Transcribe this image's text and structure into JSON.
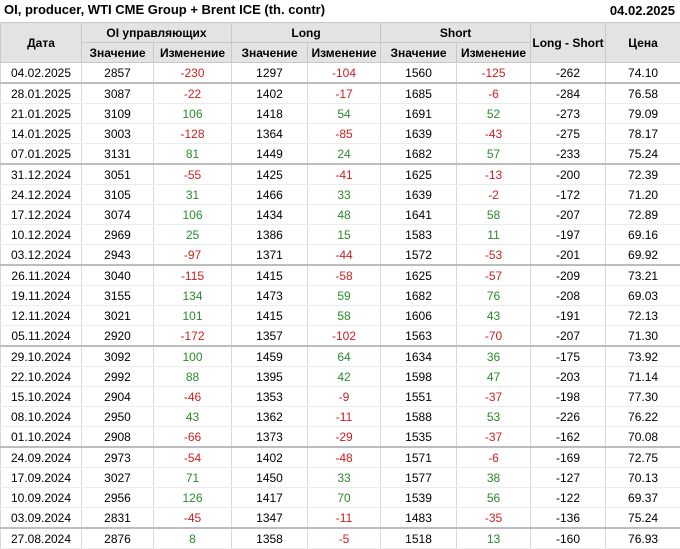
{
  "header": {
    "title": "OI, producer, WTI CME Group + Brent ICE (th. contr)",
    "date": "04.02.2025"
  },
  "columns": {
    "date": "Дата",
    "oi": "OI управляющих",
    "long": "Long",
    "short": "Short",
    "long_short": "Long - Short",
    "price": "Цена",
    "value": "Значение",
    "change": "Изменение"
  },
  "colors": {
    "positive": "#2a8a2a",
    "negative": "#cc2020",
    "header_bg": "#e3e3e3"
  },
  "rows": [
    {
      "date": "04.02.2025",
      "oi": "2857",
      "oi_chg": "-230",
      "long": "1297",
      "long_chg": "-104",
      "short": "1560",
      "short_chg": "-125",
      "ls": "-262",
      "price": "74.10"
    },
    {
      "date": "28.01.2025",
      "oi": "3087",
      "oi_chg": "-22",
      "long": "1402",
      "long_chg": "-17",
      "short": "1685",
      "short_chg": "-6",
      "ls": "-284",
      "price": "76.58"
    },
    {
      "date": "21.01.2025",
      "oi": "3109",
      "oi_chg": "106",
      "long": "1418",
      "long_chg": "54",
      "short": "1691",
      "short_chg": "52",
      "ls": "-273",
      "price": "79.09"
    },
    {
      "date": "14.01.2025",
      "oi": "3003",
      "oi_chg": "-128",
      "long": "1364",
      "long_chg": "-85",
      "short": "1639",
      "short_chg": "-43",
      "ls": "-275",
      "price": "78.17"
    },
    {
      "date": "07.01.2025",
      "oi": "3131",
      "oi_chg": "81",
      "long": "1449",
      "long_chg": "24",
      "short": "1682",
      "short_chg": "57",
      "ls": "-233",
      "price": "75.24"
    },
    {
      "date": "31.12.2024",
      "oi": "3051",
      "oi_chg": "-55",
      "long": "1425",
      "long_chg": "-41",
      "short": "1625",
      "short_chg": "-13",
      "ls": "-200",
      "price": "72.39"
    },
    {
      "date": "24.12.2024",
      "oi": "3105",
      "oi_chg": "31",
      "long": "1466",
      "long_chg": "33",
      "short": "1639",
      "short_chg": "-2",
      "ls": "-172",
      "price": "71.20"
    },
    {
      "date": "17.12.2024",
      "oi": "3074",
      "oi_chg": "106",
      "long": "1434",
      "long_chg": "48",
      "short": "1641",
      "short_chg": "58",
      "ls": "-207",
      "price": "72.89"
    },
    {
      "date": "10.12.2024",
      "oi": "2969",
      "oi_chg": "25",
      "long": "1386",
      "long_chg": "15",
      "short": "1583",
      "short_chg": "11",
      "ls": "-197",
      "price": "69.16"
    },
    {
      "date": "03.12.2024",
      "oi": "2943",
      "oi_chg": "-97",
      "long": "1371",
      "long_chg": "-44",
      "short": "1572",
      "short_chg": "-53",
      "ls": "-201",
      "price": "69.92"
    },
    {
      "date": "26.11.2024",
      "oi": "3040",
      "oi_chg": "-115",
      "long": "1415",
      "long_chg": "-58",
      "short": "1625",
      "short_chg": "-57",
      "ls": "-209",
      "price": "73.21"
    },
    {
      "date": "19.11.2024",
      "oi": "3155",
      "oi_chg": "134",
      "long": "1473",
      "long_chg": "59",
      "short": "1682",
      "short_chg": "76",
      "ls": "-208",
      "price": "69.03"
    },
    {
      "date": "12.11.2024",
      "oi": "3021",
      "oi_chg": "101",
      "long": "1415",
      "long_chg": "58",
      "short": "1606",
      "short_chg": "43",
      "ls": "-191",
      "price": "72.13"
    },
    {
      "date": "05.11.2024",
      "oi": "2920",
      "oi_chg": "-172",
      "long": "1357",
      "long_chg": "-102",
      "short": "1563",
      "short_chg": "-70",
      "ls": "-207",
      "price": "71.30"
    },
    {
      "date": "29.10.2024",
      "oi": "3092",
      "oi_chg": "100",
      "long": "1459",
      "long_chg": "64",
      "short": "1634",
      "short_chg": "36",
      "ls": "-175",
      "price": "73.92"
    },
    {
      "date": "22.10.2024",
      "oi": "2992",
      "oi_chg": "88",
      "long": "1395",
      "long_chg": "42",
      "short": "1598",
      "short_chg": "47",
      "ls": "-203",
      "price": "71.14"
    },
    {
      "date": "15.10.2024",
      "oi": "2904",
      "oi_chg": "-46",
      "long": "1353",
      "long_chg": "-9",
      "short": "1551",
      "short_chg": "-37",
      "ls": "-198",
      "price": "77.30"
    },
    {
      "date": "08.10.2024",
      "oi": "2950",
      "oi_chg": "43",
      "long": "1362",
      "long_chg": "-11",
      "short": "1588",
      "short_chg": "53",
      "ls": "-226",
      "price": "76.22"
    },
    {
      "date": "01.10.2024",
      "oi": "2908",
      "oi_chg": "-66",
      "long": "1373",
      "long_chg": "-29",
      "short": "1535",
      "short_chg": "-37",
      "ls": "-162",
      "price": "70.08"
    },
    {
      "date": "24.09.2024",
      "oi": "2973",
      "oi_chg": "-54",
      "long": "1402",
      "long_chg": "-48",
      "short": "1571",
      "short_chg": "-6",
      "ls": "-169",
      "price": "72.75"
    },
    {
      "date": "17.09.2024",
      "oi": "3027",
      "oi_chg": "71",
      "long": "1450",
      "long_chg": "33",
      "short": "1577",
      "short_chg": "38",
      "ls": "-127",
      "price": "70.13"
    },
    {
      "date": "10.09.2024",
      "oi": "2956",
      "oi_chg": "126",
      "long": "1417",
      "long_chg": "70",
      "short": "1539",
      "short_chg": "56",
      "ls": "-122",
      "price": "69.37"
    },
    {
      "date": "03.09.2024",
      "oi": "2831",
      "oi_chg": "-45",
      "long": "1347",
      "long_chg": "-11",
      "short": "1483",
      "short_chg": "-35",
      "ls": "-136",
      "price": "75.24"
    },
    {
      "date": "27.08.2024",
      "oi": "2876",
      "oi_chg": "8",
      "long": "1358",
      "long_chg": "-5",
      "short": "1518",
      "short_chg": "13",
      "ls": "-160",
      "price": "76.93"
    }
  ]
}
